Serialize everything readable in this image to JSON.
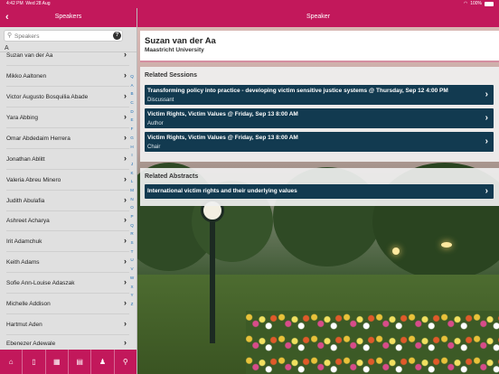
{
  "status_bar": {
    "time": "4:42 PM",
    "date": "Wed 28 Aug",
    "battery": "100%",
    "wifi_icon": "wifi-icon"
  },
  "left_nav": {
    "title": "Speakers",
    "back_icon": "chevron-left-icon"
  },
  "right_nav": {
    "title": "Speaker"
  },
  "search": {
    "placeholder": "Speakers",
    "value": ""
  },
  "list": {
    "section_letter": "A",
    "speakers": [
      "Suzan van der Aa",
      "Mikko Aaltonen",
      "Victor Augusto Bosquilia Abade",
      "Yara Abbing",
      "Omar Abdedaim Herrera",
      "Jonathan Ablitt",
      "Valeria Abreu Minero",
      "Judith Abulafia",
      "Ashreet Acharya",
      "Irit Adamchuk",
      "Keith Adams",
      "Sofie Ann-Louise Adaszak",
      "Michelle Addison",
      "Hartmut Aden",
      "Ebenezer Adewale"
    ],
    "index_letters": [
      "Q",
      "A",
      "B",
      "C",
      "D",
      "E",
      "F",
      "G",
      "H",
      "I",
      "J",
      "K",
      "L",
      "M",
      "N",
      "O",
      "P",
      "Q",
      "R",
      "S",
      "T",
      "U",
      "V",
      "W",
      "X",
      "Y",
      "Z"
    ]
  },
  "tabbar": {
    "tabs": [
      {
        "name": "home-icon",
        "glyph": "⌂"
      },
      {
        "name": "phone-icon",
        "glyph": "▯"
      },
      {
        "name": "grid-icon",
        "glyph": "▦"
      },
      {
        "name": "map-icon",
        "glyph": "▤"
      },
      {
        "name": "person-icon",
        "glyph": "♟"
      },
      {
        "name": "search-icon",
        "glyph": "⚲"
      }
    ]
  },
  "speaker": {
    "name": "Suzan van der Aa",
    "affiliation": "Maastricht University"
  },
  "related_sessions": {
    "title": "Related Sessions",
    "items": [
      {
        "title": "Transforming policy into practice - developing victim sensitive justice systems @ Thursday, Sep 12 4:00 PM",
        "role": "Discussant"
      },
      {
        "title": "Victim Rights, Victim Values @ Friday, Sep 13 8:00 AM",
        "role": "Author"
      },
      {
        "title": "Victim Rights, Victim Values @ Friday, Sep 13 8:00 AM",
        "role": "Chair"
      }
    ]
  },
  "related_abstracts": {
    "title": "Related Abstracts",
    "items": [
      {
        "title": "International victim rights and their underlying values"
      }
    ]
  },
  "colors": {
    "brand": "#c2185b",
    "session_bg": "#123a50",
    "accent_blue": "#1e6fb5"
  }
}
